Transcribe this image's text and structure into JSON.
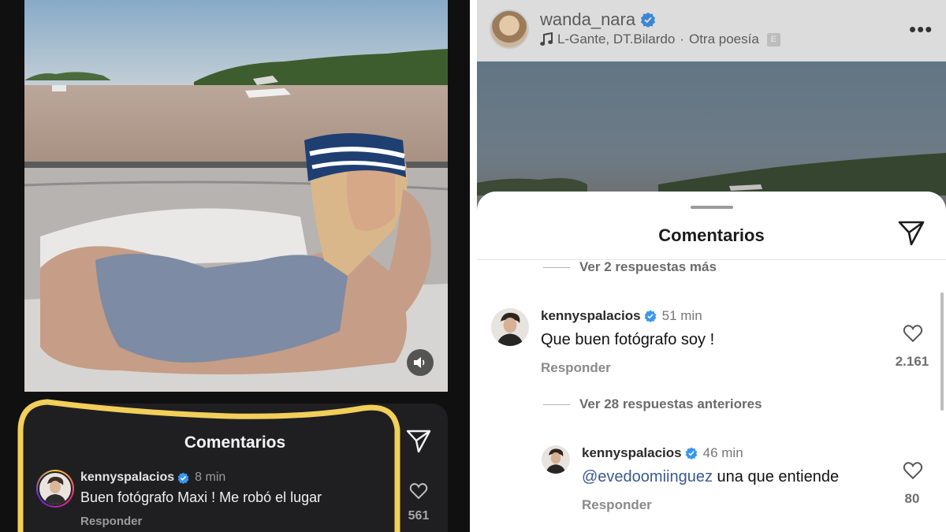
{
  "left_panel": {
    "comments_title": "Comentarios",
    "comment": {
      "username": "kennyspalacios",
      "time": "8 min",
      "text": "Buen fotógrafo Maxi ! Me robó el lugar",
      "reply_label": "Responder",
      "likes": "561"
    },
    "icons": [
      "volume-icon",
      "send-icon",
      "verified-icon",
      "heart-icon"
    ],
    "highlight_color": "#f2cf5b"
  },
  "right_panel": {
    "header": {
      "username": "wanda_nara",
      "music_artists": "L-Gante, DT.Bilardo",
      "music_separator": "·",
      "music_song": "Otra poesía",
      "explicit_badge": "E"
    },
    "comments_title": "Comentarios",
    "view_more_replies": "Ver 2 respuestas más",
    "view_previous_replies": "Ver 28 respuestas anteriores",
    "comments": [
      {
        "username": "kennyspalacios",
        "time": "51 min",
        "text": "Que buen fotógrafo soy !",
        "reply_label": "Responder",
        "likes": "2.161"
      },
      {
        "username": "kennyspalacios",
        "time": "46 min",
        "mention": "@evedoomiinguez",
        "text": " una que entiende",
        "reply_label": "Responder",
        "likes": "80"
      }
    ],
    "verified_color": "#3897f0",
    "mention_color": "#3a5a92"
  }
}
